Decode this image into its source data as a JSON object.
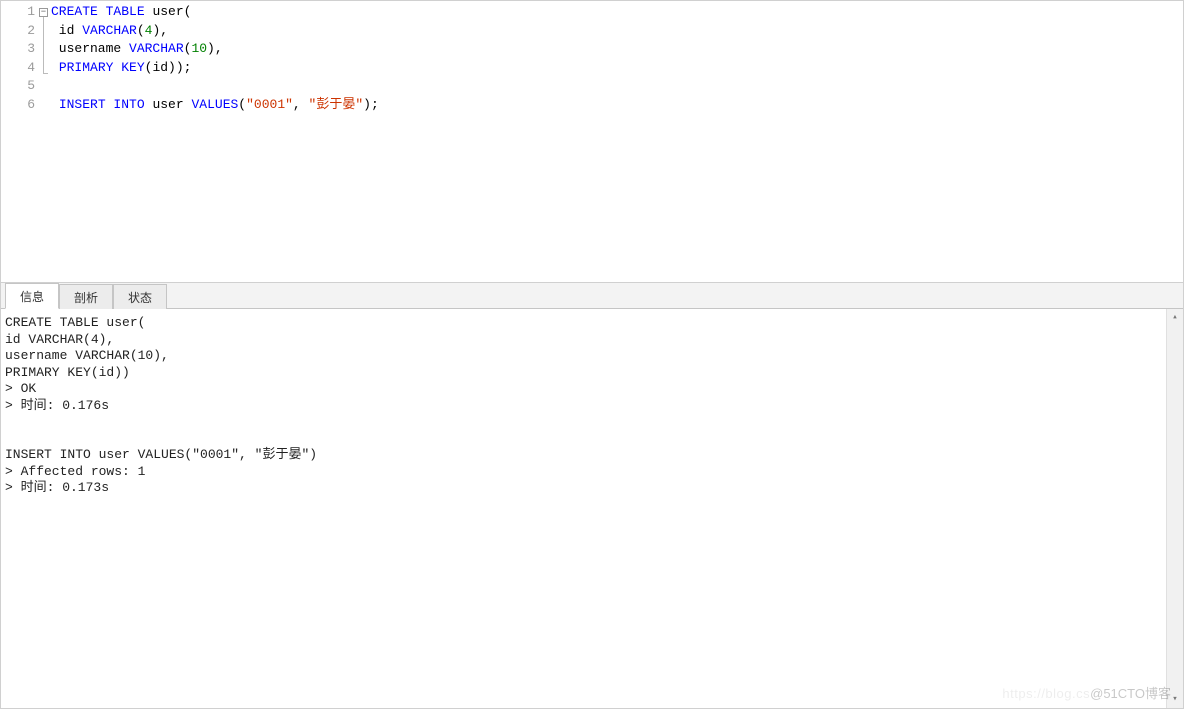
{
  "editor": {
    "line_numbers": [
      "1",
      "2",
      "3",
      "4",
      "5",
      "6"
    ],
    "fold_marker": "−",
    "lines": [
      {
        "tokens": [
          {
            "t": "CREATE TABLE",
            "c": "kw"
          },
          {
            "t": " ",
            "c": "punct"
          },
          {
            "t": "user",
            "c": "ident"
          },
          {
            "t": "(",
            "c": "punct"
          }
        ]
      },
      {
        "tokens": [
          {
            "t": " id ",
            "c": "ident"
          },
          {
            "t": "VARCHAR",
            "c": "type"
          },
          {
            "t": "(",
            "c": "punct"
          },
          {
            "t": "4",
            "c": "num"
          },
          {
            "t": "),",
            "c": "punct"
          }
        ]
      },
      {
        "tokens": [
          {
            "t": " username ",
            "c": "ident"
          },
          {
            "t": "VARCHAR",
            "c": "type"
          },
          {
            "t": "(",
            "c": "punct"
          },
          {
            "t": "10",
            "c": "num"
          },
          {
            "t": "),",
            "c": "punct"
          }
        ]
      },
      {
        "tokens": [
          {
            "t": " ",
            "c": "punct"
          },
          {
            "t": "PRIMARY KEY",
            "c": "kw"
          },
          {
            "t": "(id));",
            "c": "punct"
          }
        ]
      },
      {
        "tokens": [
          {
            "t": "",
            "c": "punct"
          }
        ]
      },
      {
        "tokens": [
          {
            "t": " ",
            "c": "punct"
          },
          {
            "t": "INSERT INTO",
            "c": "kw"
          },
          {
            "t": " ",
            "c": "punct"
          },
          {
            "t": "user",
            "c": "ident"
          },
          {
            "t": " ",
            "c": "punct"
          },
          {
            "t": "VALUES",
            "c": "kw"
          },
          {
            "t": "(",
            "c": "punct"
          },
          {
            "t": "\"0001\"",
            "c": "str"
          },
          {
            "t": ", ",
            "c": "punct"
          },
          {
            "t": "\"彭于晏\"",
            "c": "str"
          },
          {
            "t": ");",
            "c": "punct"
          }
        ]
      }
    ]
  },
  "tabs": {
    "items": [
      {
        "label": "信息",
        "active": true
      },
      {
        "label": "剖析",
        "active": false
      },
      {
        "label": "状态",
        "active": false
      }
    ]
  },
  "output": {
    "text": "CREATE TABLE user(\nid VARCHAR(4),\nusername VARCHAR(10),\nPRIMARY KEY(id))\n> OK\n> 时间: 0.176s\n\n\nINSERT INTO user VALUES(\"0001\", \"彭于晏\")\n> Affected rows: 1\n> 时间: 0.173s"
  },
  "watermark": {
    "faint": "https://blog.cs",
    "text": "@51CTO博客"
  },
  "scroll": {
    "up": "▴",
    "down": "▾"
  }
}
